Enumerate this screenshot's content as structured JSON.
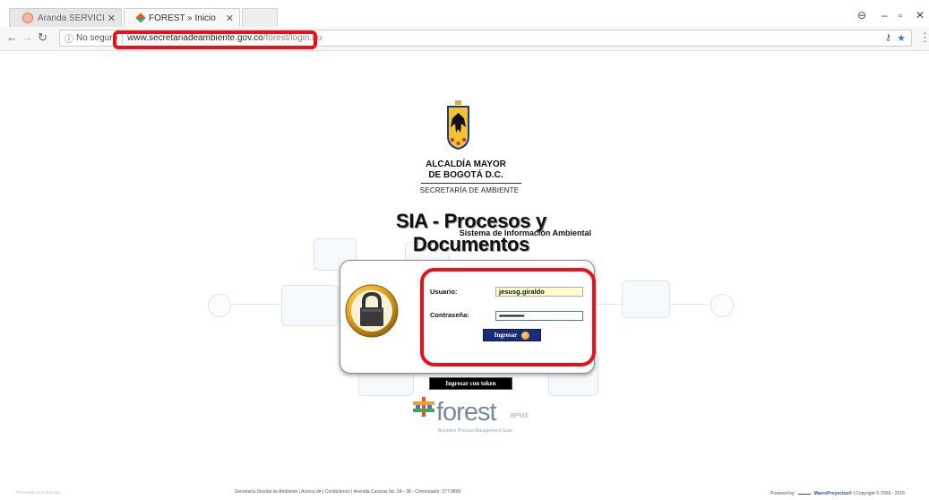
{
  "browser": {
    "tabs": [
      {
        "label": "Aranda SERVICE DESK®",
        "active": false
      },
      {
        "label": "FOREST » Inicio",
        "active": true
      }
    ],
    "security_label": "No seguro",
    "url_host": "www.secretariadeambiente.gov.co",
    "url_path": "/forest/login.do"
  },
  "header": {
    "org_line1": "ALCALDÍA MAYOR",
    "org_line2": "DE BOGOTÁ D.C.",
    "org_department": "SECRETARÍA DE AMBIENTE",
    "app_title": "SIA - Procesos y Documentos",
    "app_subtitle": "Sistema de Información Ambiental"
  },
  "login": {
    "user_label": "Usuario:",
    "user_value": "jesusg.giraldo",
    "password_label": "Contraseña:",
    "password_value": "•••••••••••••••••",
    "submit_label": "Ingresar",
    "token_label": "Ingresar con token"
  },
  "brand": {
    "name": "forest",
    "suffix": "BPMS",
    "tagline": "Business Process Management Suite"
  },
  "footer": {
    "left": "Procesado en 0.001 seg",
    "middle": "Secretaría Distrital de Ambiente   |   Acerca de   |   Contáctenos   |   Avenida Caracas No. 54 - 38 - Conmutador: 377 8899",
    "right_prefix": "Powered by:",
    "right_brand": "MacroProyectos®",
    "right_suffix": "| Copyright © 2009 - 2018"
  },
  "colors": {
    "highlight": "#e8101a",
    "button_bg": "#1a2e78",
    "username_bg": "#ffffcc"
  }
}
